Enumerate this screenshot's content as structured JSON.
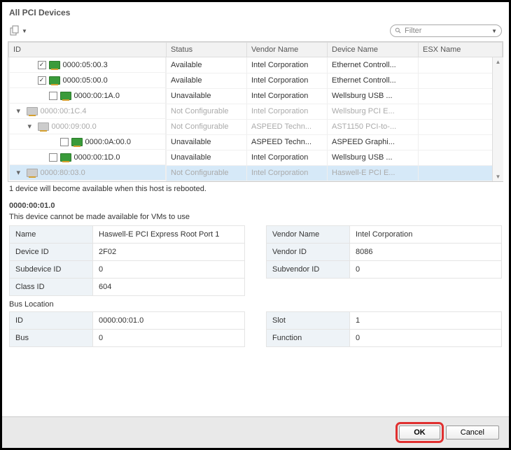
{
  "header": {
    "title": "All PCI Devices"
  },
  "toolbar": {
    "filter_placeholder": "Filter"
  },
  "columns": [
    "ID",
    "Status",
    "Vendor Name",
    "Device Name",
    "ESX Name"
  ],
  "rows": [
    {
      "indent": 1,
      "arrow": "",
      "checkbox": true,
      "checked": true,
      "icon": "green",
      "id_text": "0000:05:00.3",
      "status": "Available",
      "vendor": "Intel Corporation",
      "device": "Ethernet Controll...",
      "dim": false,
      "sel": false
    },
    {
      "indent": 1,
      "arrow": "",
      "checkbox": true,
      "checked": true,
      "icon": "green",
      "id_text": "0000:05:00.0",
      "status": "Available",
      "vendor": "Intel Corporation",
      "device": "Ethernet Controll...",
      "dim": false,
      "sel": false
    },
    {
      "indent": 2,
      "arrow": "",
      "checkbox": true,
      "checked": false,
      "icon": "green",
      "id_text": "0000:00:1A.0",
      "status": "Unavailable",
      "vendor": "Intel Corporation",
      "device": "Wellsburg USB ...",
      "dim": false,
      "sel": false
    },
    {
      "indent": 0,
      "arrow": "▾",
      "checkbox": false,
      "checked": false,
      "icon": "dim",
      "id_text": "0000:00:1C.4",
      "status": "Not Configurable",
      "vendor": "Intel Corporation",
      "device": "Wellsburg PCI E...",
      "dim": true,
      "sel": false
    },
    {
      "indent": 1,
      "arrow": "▾",
      "checkbox": false,
      "checked": false,
      "icon": "dim",
      "id_text": "0000:09:00.0",
      "status": "Not Configurable",
      "vendor": "ASPEED Techn...",
      "device": "AST1150 PCI-to-...",
      "dim": true,
      "sel": false
    },
    {
      "indent": 3,
      "arrow": "",
      "checkbox": true,
      "checked": false,
      "icon": "green",
      "id_text": "0000:0A:00.0",
      "status": "Unavailable",
      "vendor": "ASPEED Techn...",
      "device": "ASPEED Graphi...",
      "dim": false,
      "sel": false
    },
    {
      "indent": 2,
      "arrow": "",
      "checkbox": true,
      "checked": false,
      "icon": "green",
      "id_text": "0000:00:1D.0",
      "status": "Unavailable",
      "vendor": "Intel Corporation",
      "device": "Wellsburg USB ...",
      "dim": false,
      "sel": false
    },
    {
      "indent": 0,
      "arrow": "▾",
      "checkbox": false,
      "checked": false,
      "icon": "dim",
      "id_text": "0000:80:03.0",
      "status": "Not Configurable",
      "vendor": "Intel Corporation",
      "device": "Haswell-E PCI E...",
      "dim": true,
      "sel": true
    }
  ],
  "note_text": "1 device will become available when this host is rebooted.",
  "detail": {
    "title": "0000:00:01.0",
    "subtitle": "This device cannot be made available for VMs to use",
    "left": [
      {
        "k": "Name",
        "v": "Haswell-E PCI Express Root Port 1"
      },
      {
        "k": "Device ID",
        "v": "2F02"
      },
      {
        "k": "Subdevice ID",
        "v": "0"
      },
      {
        "k": "Class ID",
        "v": "604"
      }
    ],
    "right": [
      {
        "k": "Vendor Name",
        "v": "Intel Corporation"
      },
      {
        "k": "Vendor ID",
        "v": "8086"
      },
      {
        "k": "Subvendor ID",
        "v": "0"
      }
    ],
    "bus_label": "Bus Location",
    "bus_left": [
      {
        "k": "ID",
        "v": "0000:00:01.0"
      },
      {
        "k": "Bus",
        "v": "0"
      }
    ],
    "bus_right": [
      {
        "k": "Slot",
        "v": "1"
      },
      {
        "k": "Function",
        "v": "0"
      }
    ]
  },
  "footer": {
    "ok": "OK",
    "cancel": "Cancel"
  }
}
